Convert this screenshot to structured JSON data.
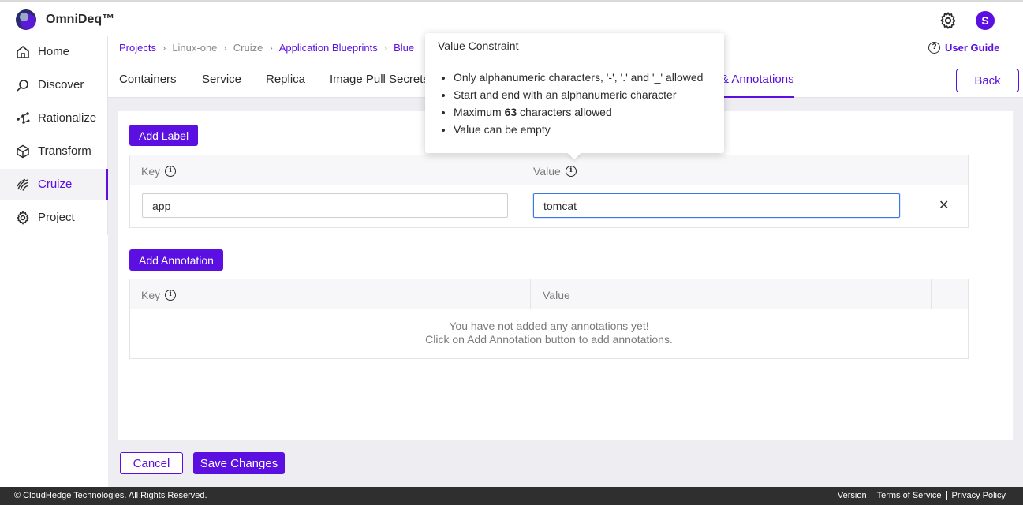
{
  "app": {
    "name": "OmniDeq™",
    "avatar_initial": "S"
  },
  "sidebar": {
    "items": [
      {
        "label": "Home",
        "icon": "home-icon"
      },
      {
        "label": "Discover",
        "icon": "discover-icon"
      },
      {
        "label": "Rationalize",
        "icon": "rationalize-icon"
      },
      {
        "label": "Transform",
        "icon": "cube-icon"
      },
      {
        "label": "Cruize",
        "icon": "cruize-icon",
        "active": true
      },
      {
        "label": "Project",
        "icon": "gear-icon"
      }
    ]
  },
  "breadcrumb": {
    "items": [
      "Projects",
      "Linux-one",
      "Cruize",
      "Application Blueprints",
      "Blue"
    ]
  },
  "user_guide": "User Guide",
  "tabs": [
    "Containers",
    "Service",
    "Replica",
    "Image Pull Secrets",
    "& Annotations"
  ],
  "back_label": "Back",
  "labels_section": {
    "add_button": "Add Label",
    "headers": {
      "key": "Key",
      "value": "Value"
    },
    "rows": [
      {
        "key": "app",
        "value": "tomcat"
      }
    ],
    "remove_glyph": "✕"
  },
  "annotations_section": {
    "add_button": "Add Annotation",
    "headers": {
      "key": "Key",
      "value": "Value"
    },
    "empty_line1": "You have not added any annotations yet!",
    "empty_line2": "Click on Add Annotation button to add annotations."
  },
  "actions": {
    "cancel": "Cancel",
    "save": "Save Changes"
  },
  "footer": {
    "copyright": "© CloudHedge Technologies. All Rights Reserved.",
    "links": [
      "Version",
      "Terms of Service",
      "Privacy Policy"
    ]
  },
  "tooltip": {
    "title": "Value Constraint",
    "items": {
      "allowed": "Only alphanumeric characters, '-', '.' and '_' allowed",
      "start_end": "Start and end with an alphanumeric character",
      "max_prefix": "Maximum ",
      "max_value": "63",
      "max_suffix": " characters allowed",
      "empty": "Value can be empty"
    }
  },
  "colors": {
    "accent": "#5b0fe0",
    "footer_bg": "#2f2f2f",
    "focus": "#3a78e8"
  }
}
